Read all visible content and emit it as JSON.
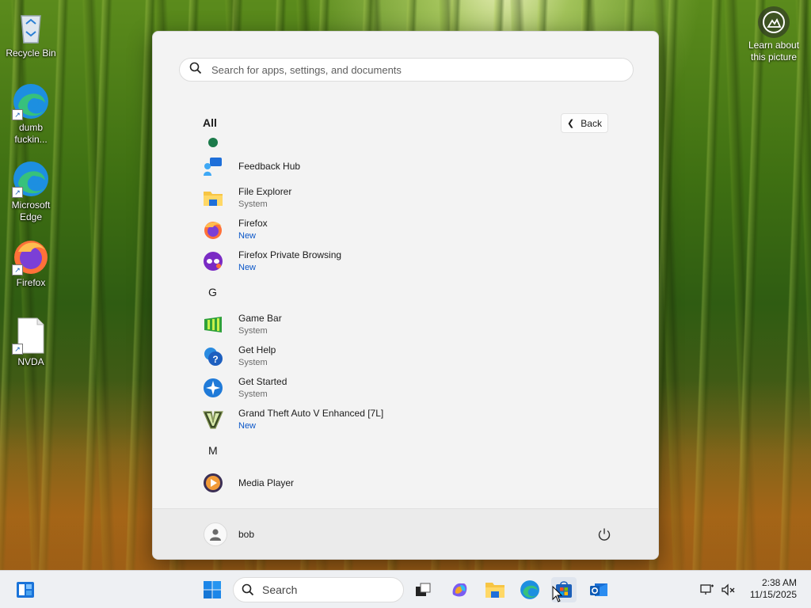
{
  "desktop": {
    "icons": [
      {
        "label": "Recycle Bin"
      },
      {
        "label": "dumb fuckin..."
      },
      {
        "label": "Microsoft Edge"
      },
      {
        "label": "Firefox"
      },
      {
        "label": "NVDA"
      }
    ],
    "learn_label": "Learn about this picture"
  },
  "start_menu": {
    "search_placeholder": "Search for apps, settings, and documents",
    "section_title": "All",
    "back_label": "Back",
    "apps": [
      {
        "name": "Feedback Hub",
        "sub": "",
        "icon": "feedback-hub-icon"
      },
      {
        "name": "File Explorer",
        "sub": "System",
        "icon": "file-explorer-icon"
      },
      {
        "name": "Firefox",
        "sub": "New",
        "icon": "firefox-icon"
      },
      {
        "name": "Firefox Private Browsing",
        "sub": "New",
        "icon": "firefox-private-icon"
      },
      {
        "name": "Game Bar",
        "sub": "System",
        "icon": "game-bar-icon"
      },
      {
        "name": "Get Help",
        "sub": "System",
        "icon": "get-help-icon"
      },
      {
        "name": "Get Started",
        "sub": "System",
        "icon": "get-started-icon"
      },
      {
        "name": "Grand Theft Auto V Enhanced [7L]",
        "sub": "New",
        "icon": "gta-icon"
      },
      {
        "name": "Media Player",
        "sub": "",
        "icon": "media-player-icon"
      }
    ],
    "letters": [
      "G",
      "M"
    ],
    "user_name": "bob"
  },
  "taskbar": {
    "search_label": "Search",
    "time": "2:38 AM",
    "date": "11/15/2025",
    "items": [
      "widgets-icon",
      "start-icon",
      "task-view-icon",
      "copilot-icon",
      "file-explorer-icon",
      "edge-icon",
      "store-icon",
      "outlook-icon"
    ]
  },
  "colors": {
    "accent_new": "#0b57c8",
    "menu_bg": "#f3f3f3",
    "taskbar_bg": "#eef0f3"
  }
}
